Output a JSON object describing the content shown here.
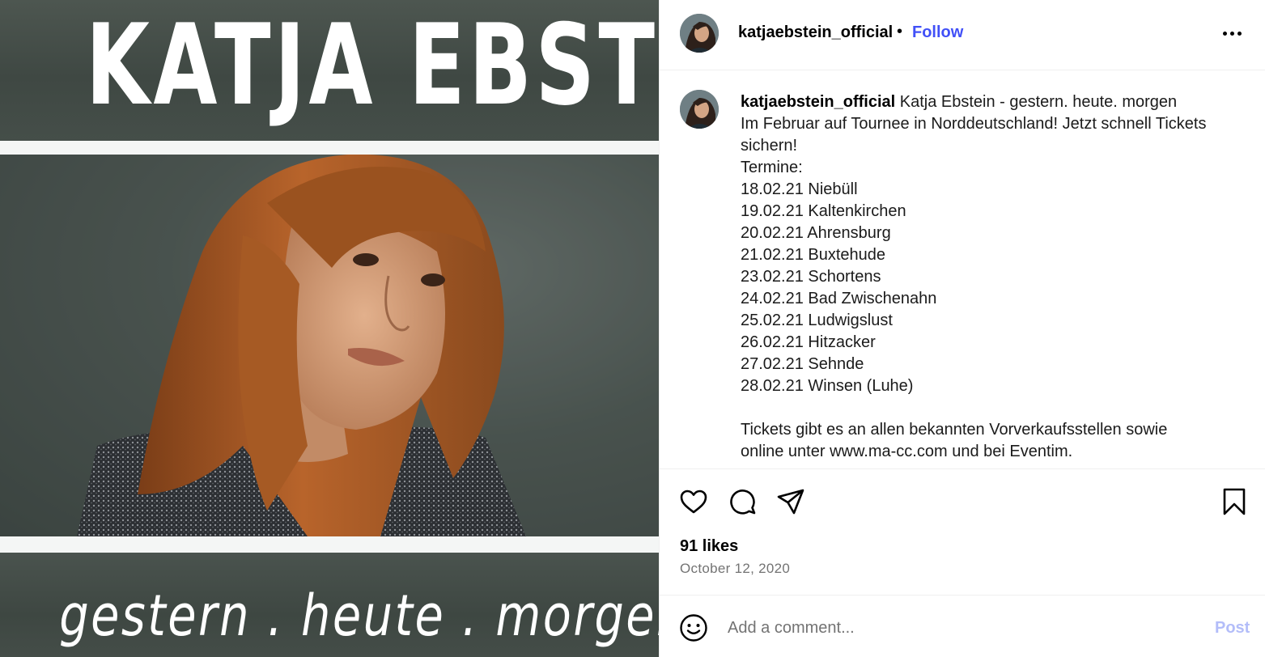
{
  "media": {
    "poster_title": "KATJA EBSTEIN",
    "poster_subtitle": "gestern . heute . morgen"
  },
  "header": {
    "username": "katjaebstein_official",
    "separator": "•",
    "follow_label": "Follow",
    "more_icon": "more-options-icon"
  },
  "caption": {
    "username": "katjaebstein_official",
    "lines": [
      "Katja Ebstein - gestern. heute. morgen",
      "Im Februar auf Tournee in Norddeutschland! Jetzt schnell Tickets",
      "sichern!",
      "Termine:",
      "18.02.21 Niebüll",
      "19.02.21 Kaltenkirchen",
      "20.02.21 Ahrensburg",
      "21.02.21 Buxtehude",
      "23.02.21 Schortens",
      "24.02.21 Bad Zwischenahn",
      "25.02.21 Ludwigslust",
      "26.02.21 Hitzacker",
      "27.02.21 Sehnde",
      "28.02.21 Winsen (Luhe)",
      "",
      "Tickets gibt es an allen bekannten Vorverkaufsstellen sowie",
      "online unter www.ma-cc.com und bei Eventim."
    ]
  },
  "actions": {
    "icons": [
      "heart-icon",
      "comment-icon",
      "share-icon",
      "bookmark-icon"
    ]
  },
  "likes": "91 likes",
  "date": "October 12, 2020",
  "comment": {
    "placeholder": "Add a comment...",
    "value": "",
    "post_label": "Post",
    "emoji_icon": "emoji-icon"
  }
}
